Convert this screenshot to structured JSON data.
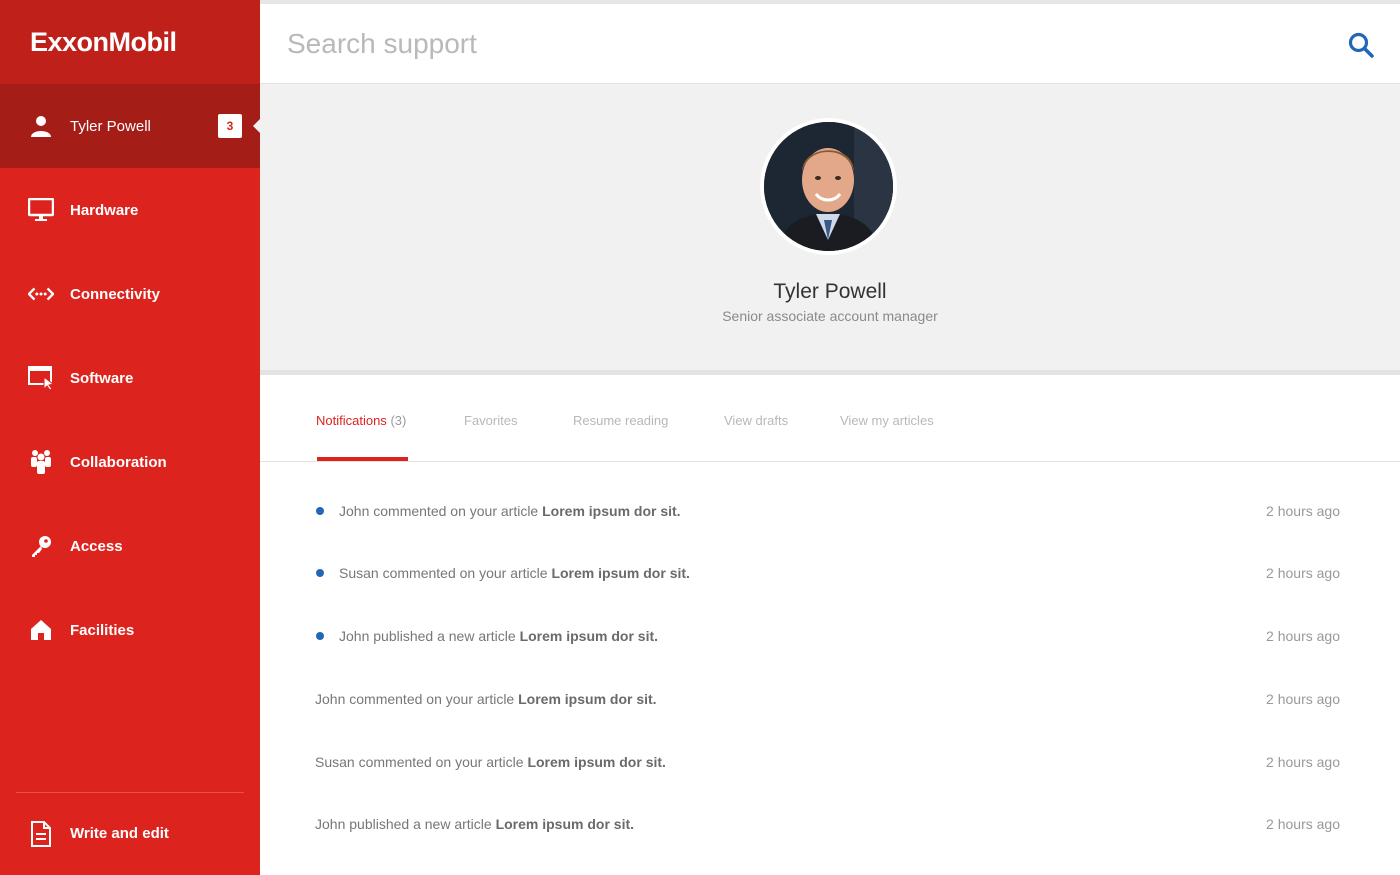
{
  "brand": {
    "logo": "ExxonMobil"
  },
  "user": {
    "name": "Tyler Powell",
    "badge_count": "3",
    "role": "Senior associate account manager"
  },
  "sidebar": {
    "items": [
      {
        "label": "Hardware",
        "icon": "monitor-icon"
      },
      {
        "label": "Connectivity",
        "icon": "connectivity-icon"
      },
      {
        "label": "Software",
        "icon": "software-window-icon"
      },
      {
        "label": "Collaboration",
        "icon": "people-icon"
      },
      {
        "label": "Access",
        "icon": "key-icon"
      },
      {
        "label": "Facilities",
        "icon": "home-icon"
      }
    ],
    "write": {
      "label": "Write and edit",
      "icon": "document-icon"
    }
  },
  "search": {
    "placeholder": "Search support",
    "icon": "search-icon"
  },
  "tabs": [
    {
      "label": "Notifications",
      "count": "(3)",
      "active": true
    },
    {
      "label": "Favorites"
    },
    {
      "label": "Resume reading"
    },
    {
      "label": "View drafts"
    },
    {
      "label": "View my articles"
    }
  ],
  "notifications": [
    {
      "text": "John commented on your article ",
      "article": "Lorem ipsum dor sit.",
      "time": "2 hours ago",
      "unread": true
    },
    {
      "text": "Susan commented on your article ",
      "article": "Lorem ipsum dor sit.",
      "time": "2 hours ago",
      "unread": true
    },
    {
      "text": "John published a new article ",
      "article": "Lorem ipsum dor sit.",
      "time": "2 hours ago",
      "unread": true
    },
    {
      "text": "John commented on your article ",
      "article": "Lorem ipsum dor sit.",
      "time": "2 hours ago",
      "unread": false
    },
    {
      "text": "Susan commented on your article ",
      "article": "Lorem ipsum dor sit.",
      "time": "2 hours ago",
      "unread": false
    },
    {
      "text": "John published a new article ",
      "article": "Lorem ipsum dor sit.",
      "time": "2 hours ago",
      "unread": false
    }
  ],
  "colors": {
    "brand_red": "#dc231e",
    "active_red": "#a51d17",
    "unread_dot": "#2366b8"
  }
}
